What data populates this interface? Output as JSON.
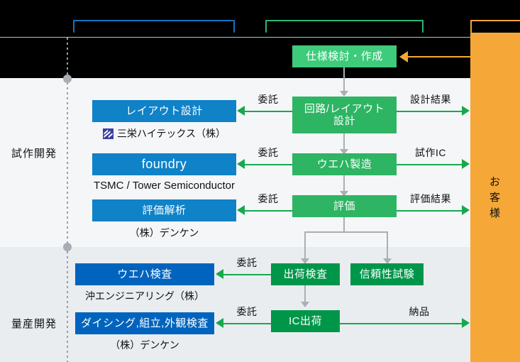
{
  "diagram": {
    "title": "semiconductor development flow",
    "top_brackets": [
      {
        "name": "bracket-blue",
        "color": "#1273c0",
        "label": ""
      },
      {
        "name": "bracket-green",
        "color": "#2bb673",
        "label": ""
      },
      {
        "name": "bracket-orange",
        "color": "#f2a33c",
        "label": ""
      }
    ],
    "phases": [
      {
        "label": "試作開発"
      },
      {
        "label": "量産開発"
      }
    ],
    "customer": {
      "label_chars": [
        "お",
        "客",
        "様"
      ],
      "color": "#f5a837"
    },
    "spec_box": {
      "label": "仕様検討・作成",
      "color": "#3ecb7b"
    },
    "center_boxes": [
      {
        "label_line1": "回路/レイアウト",
        "label_line2": "設計",
        "color": "#2db563"
      },
      {
        "label_line1": "ウエハ製造",
        "label_line2": "",
        "color": "#2db563"
      },
      {
        "label_line1": "評価",
        "label_line2": "",
        "color": "#2db563"
      },
      {
        "label_line1": "出荷検査",
        "label_line2": "",
        "color": "#00964a"
      },
      {
        "label_line1": "信頼性試験",
        "label_line2": "",
        "color": "#00964a"
      },
      {
        "label_line1": "IC出荷",
        "label_line2": "",
        "color": "#00964a"
      }
    ],
    "partner_boxes": [
      {
        "label": "レイアウト設計",
        "vendor": "三栄ハイテックス（株）",
        "color": "#0f82c8",
        "has_logo": true
      },
      {
        "label": "foundry",
        "vendor": "TSMC / Tower Semiconductor",
        "color": "#0f82c8",
        "has_logo": false
      },
      {
        "label": "評価解析",
        "vendor": "（株）デンケン",
        "color": "#0f82c8",
        "has_logo": false
      },
      {
        "label": "ウエハ検査",
        "vendor": "沖エンジニアリング（株）",
        "color": "#0064be",
        "has_logo": false
      },
      {
        "label": "ダイシング,組立,外観検査",
        "vendor": "（株）デンケン",
        "color": "#0064be",
        "has_logo": false
      }
    ],
    "edge_labels": {
      "itaku_1": "委託",
      "itaku_2": "委託",
      "itaku_3": "委託",
      "itaku_4": "委託",
      "itaku_5": "委託",
      "sekkei_kekka": "設計結果",
      "shisaku_ic": "試作IC",
      "hyoka_kekka": "評価結果",
      "nouhin": "納品"
    }
  }
}
